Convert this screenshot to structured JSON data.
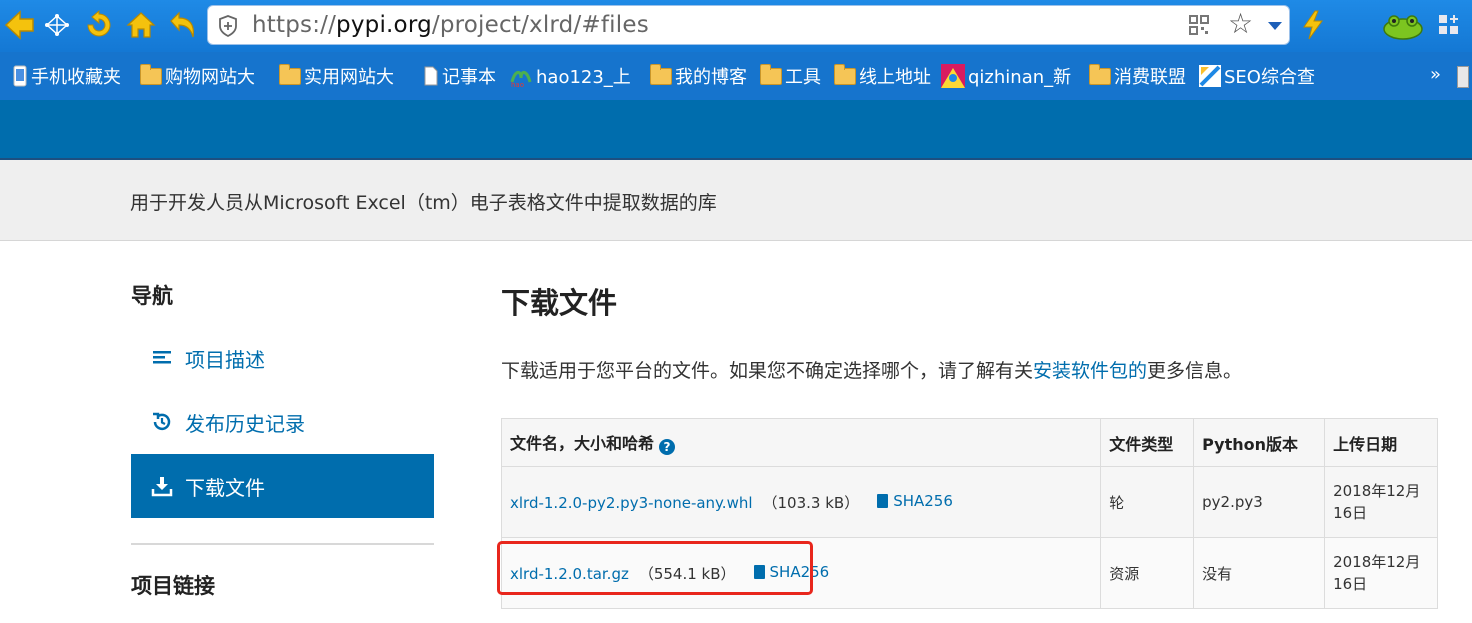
{
  "browser": {
    "url_prefix": "https://",
    "url_host": "pypi.org",
    "url_path": "/project/xlrd/#files",
    "icons": [
      "back-icon",
      "network-icon",
      "refresh-icon",
      "home-icon",
      "undo-icon",
      "shield-icon",
      "qr-code-icon",
      "star-icon",
      "chevron-down-icon",
      "lightning-icon",
      "frog-icon",
      "grid-icon"
    ]
  },
  "bookmarks": [
    {
      "label": "手机收藏夹",
      "icon": "phone-icon"
    },
    {
      "label": "购物网站大",
      "icon": "folder-icon"
    },
    {
      "label": "实用网站大",
      "icon": "folder-icon"
    },
    {
      "label": "记事本",
      "icon": "document-icon"
    },
    {
      "label": "hao123_上",
      "icon": "hao123-icon"
    },
    {
      "label": "我的博客",
      "icon": "folder-icon"
    },
    {
      "label": "工具",
      "icon": "folder-icon"
    },
    {
      "label": "线上地址",
      "icon": "folder-icon"
    },
    {
      "label": "qizhinan_新",
      "icon": "site-icon"
    },
    {
      "label": "消费联盟",
      "icon": "folder-icon"
    },
    {
      "label": "SEO综合查",
      "icon": "seo-icon"
    }
  ],
  "bookmarks_more": "»",
  "summary": "用于开发人员从Microsoft Excel（tm）电子表格文件中提取数据的库",
  "sidebar": {
    "title": "导航",
    "items": [
      {
        "label": "项目描述",
        "icon": "list-icon"
      },
      {
        "label": "发布历史记录",
        "icon": "history-icon"
      },
      {
        "label": "下载文件",
        "icon": "download-icon"
      }
    ],
    "links_title": "项目链接"
  },
  "main": {
    "title": "下载文件",
    "desc_before": "下载适用于您平台的文件。如果您不确定选择哪个，请了解有关",
    "desc_link": "安装软件包的",
    "desc_after": "更多信息。",
    "table": {
      "headers": [
        "文件名，大小和哈希",
        "文件类型",
        "Python版本",
        "上传日期"
      ],
      "help_glyph": "?",
      "rows": [
        {
          "filename": "xlrd-1.2.0-py2.py3-none-any.whl",
          "size": "（103.3 kB）",
          "hash": "SHA256",
          "type": "轮",
          "python": "py2.py3",
          "date_line1": "2018年12月",
          "date_line2": "16日"
        },
        {
          "filename": "xlrd-1.2.0.tar.gz",
          "size": "（554.1 kB）",
          "hash": "SHA256",
          "type": "资源",
          "python": "没有",
          "date_line1": "2018年12月",
          "date_line2": "16日"
        }
      ]
    }
  },
  "colors": {
    "pypi_blue": "#006dad",
    "toolbar_blue": "#1478d4",
    "highlight_red": "#e8261c"
  }
}
